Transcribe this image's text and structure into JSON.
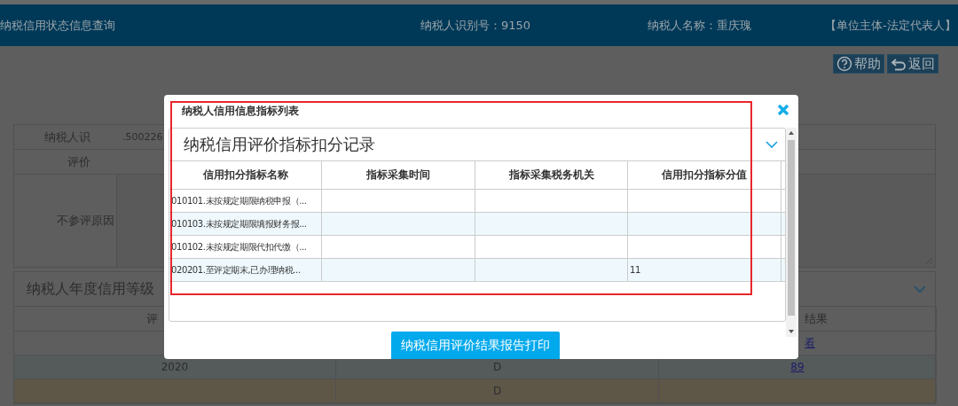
{
  "header": {
    "title": "纳税信用状态信息查询",
    "taxpayer_id": "纳税人识别号：9150",
    "taxpayer_name": "纳税人名称：重庆瑰",
    "role": "【单位主体-法定代表人】"
  },
  "toolbar": [
    {
      "kind": "help",
      "label": "帮助"
    },
    {
      "kind": "back",
      "label": "返回"
    }
  ],
  "form": [
    {
      "kind": "text",
      "label": "纳税人识",
      "value": ".500226"
    },
    {
      "kind": "text",
      "label": "评价"
    },
    {
      "kind": "textarea",
      "label": "不参评原因"
    }
  ],
  "grade_panel": {
    "title": "纳税人年度信用等级",
    "expanded": true,
    "columns": [
      "评",
      "",
      "结果"
    ],
    "rows": [
      {
        "cells": [
          "",
          "",
          "看"
        ],
        "kind": "link"
      },
      {
        "cells": [
          "2020",
          "D",
          "89"
        ],
        "kind": "normal"
      },
      {
        "cells": [
          "",
          "D",
          ""
        ],
        "kind": "highlight"
      }
    ]
  },
  "modal": {
    "title": "纳税人信用信息指标列表",
    "section_title": "纳税信用评价指标扣分记录",
    "expanded": true,
    "columns": [
      "信用扣分指标名称",
      "指标采集时间",
      "指标采集税务机关",
      "信用扣分指标分值"
    ],
    "rows": [
      [
        "010101.未按规定期限纳税申报（...",
        "",
        "",
        ""
      ],
      [
        "010103.未按规定期限填报财务报...",
        "",
        "",
        ""
      ],
      [
        "010102.未按规定期限代扣代缴（...",
        "",
        "",
        ""
      ],
      [
        "020201.至评定期末,已办理纳税...",
        "",
        "",
        "11"
      ]
    ],
    "print_button": "纳税信用评价结果报告打印"
  }
}
